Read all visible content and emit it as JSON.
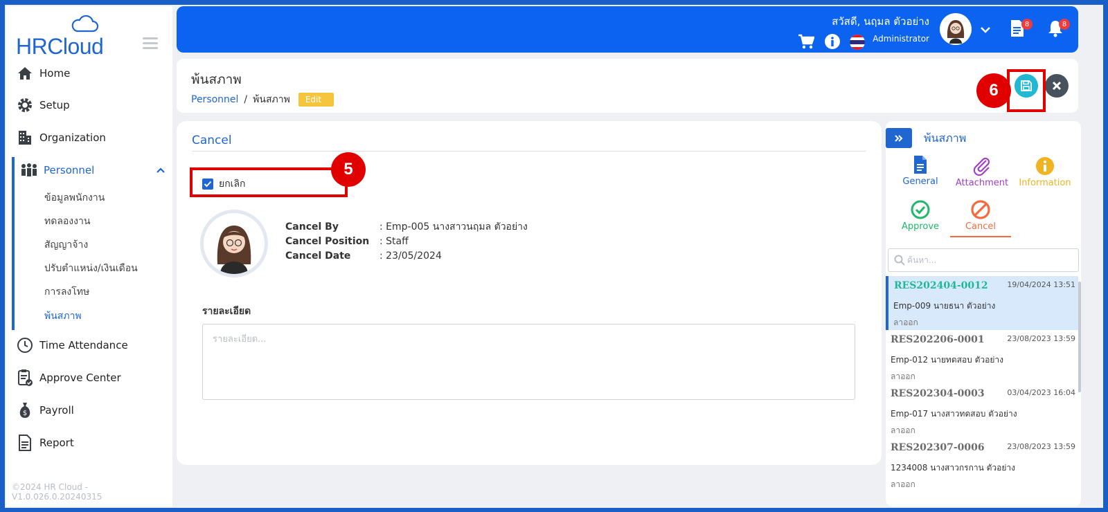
{
  "app": {
    "logo_text": "HRCloud",
    "copyright": "©2024 HR Cloud -V1.0.026.0.20240315"
  },
  "sidebar": {
    "items": [
      {
        "label": "Home",
        "icon": "home-icon"
      },
      {
        "label": "Setup",
        "icon": "gear-icon"
      },
      {
        "label": "Organization",
        "icon": "building-icon"
      },
      {
        "label": "Personnel",
        "icon": "people-icon"
      },
      {
        "label": "Time Attendance",
        "icon": "clock-icon"
      },
      {
        "label": "Approve Center",
        "icon": "clipboard-check-icon"
      },
      {
        "label": "Payroll",
        "icon": "money-bag-icon"
      },
      {
        "label": "Report",
        "icon": "document-icon"
      }
    ],
    "personnel_sub": [
      {
        "label": "ข้อมูลพนักงาน"
      },
      {
        "label": "ทดลองงาน"
      },
      {
        "label": "สัญญาจ้าง"
      },
      {
        "label": "ปรับตำแหน่ง/เงินเดือน"
      },
      {
        "label": "การลงโทษ"
      },
      {
        "label": "พ้นสภาพ"
      }
    ]
  },
  "header": {
    "greeting": "สวัสดี, นฤมล ตัวอย่าง",
    "role": "Administrator",
    "doc_badge": "8",
    "bell_badge": "8"
  },
  "page": {
    "title": "พ้นสภาพ",
    "breadcrumb_root": "Personnel",
    "breadcrumb_sep": "/",
    "breadcrumb_current": "พ้นสภาพ",
    "mode_badge": "Edit",
    "step5": "5",
    "step6": "6"
  },
  "form": {
    "section_title": "Cancel",
    "checkbox_label": "ยกเลิก",
    "cancel_by_label": "Cancel By",
    "cancel_by_value": ": Emp-005 นางสาวนฤมล ตัวอย่าง",
    "cancel_position_label": "Cancel Position",
    "cancel_position_value": ": Staff",
    "cancel_date_label": "Cancel Date",
    "cancel_date_value": ": 23/05/2024",
    "detail_label": "รายละเอียด",
    "detail_placeholder": "รายละเอียด..."
  },
  "right_panel": {
    "title": "พ้นสภาพ",
    "icons": {
      "general": "General",
      "attachment": "Attachment",
      "information": "Information",
      "approve": "Approve",
      "cancel": "Cancel"
    },
    "search_placeholder": "ค้นหา...",
    "records": [
      {
        "code": "RES202404-0012",
        "date": "19/04/2024 13:51",
        "employee": "Emp-009 นายธนา ตัวอย่าง",
        "status": "ลาออก"
      },
      {
        "code": "RES202206-0001",
        "date": "23/08/2023 13:59",
        "employee": "Emp-012 นายทดสอบ ตัวอย่าง",
        "status": "ลาออก"
      },
      {
        "code": "RES202304-0003",
        "date": "03/04/2023 16:04",
        "employee": "Emp-017 นางสาวทดสอบ ตัวอย่าง",
        "status": "ลาออก"
      },
      {
        "code": "RES202307-0006",
        "date": "23/08/2023 13:59",
        "employee": "1234008 นางสาวกรกาน ตัวอย่าง",
        "status": "ลาออก"
      }
    ]
  },
  "colors": {
    "primary": "#0b63f0",
    "accent": "#1f66d0",
    "highlight": "#e00000",
    "save": "#22b7d3"
  }
}
